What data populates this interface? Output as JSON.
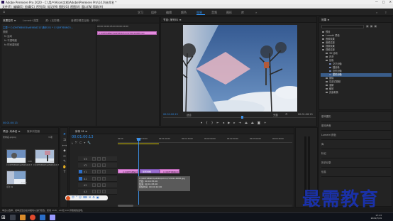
{
  "window": {
    "title": "Adobe Premiere Pro 2020 - C:\\用户\\Alice\\文档\\Adobe\\Premiere Pro\\14.0\\未命名 *",
    "controls": [
      "—",
      "□",
      "✕"
    ]
  },
  "menubar": [
    "文件(F)",
    "编辑(E)",
    "剪辑(C)",
    "序列(S)",
    "标记(M)",
    "图形(G)",
    "视图(V)",
    "窗口(W)",
    "帮助(H)"
  ],
  "workspaces": {
    "items": [
      "学习",
      "组件",
      "编辑",
      "颜色",
      "效果",
      "音频",
      "图形",
      "库"
    ],
    "active_index": 4
  },
  "source_panel": {
    "tabs": [
      "效果控件 ≡",
      "Lumetri 范围",
      "源：(无剪辑)",
      "音频剪辑混合器：序列01"
    ],
    "clip_path": "主要 * C:\\DMT6BN03\\s6f46\\6211\\7...",
    "sequence_ref": "序列 01 * C:\\DMT6BN03...",
    "sections": [
      "视频",
      "fx 运动",
      "fx 不透明度",
      "fx 时间重映射"
    ],
    "mini_timecode": "00:00    00:00:05:00   00:00:10:00",
    "mini_clip_label": "C:\\DMT6BN03\\s6f46\\6211\\7230214688.jpg",
    "bottom_timecode": "00:01:00:13"
  },
  "program_monitor": {
    "tab": "节目: 序列01 ≡",
    "timecode_current": "00:01:00:13",
    "fit": "适合",
    "quality": "完整",
    "timecode_total": "00:01:08:13",
    "transport_icons": [
      "marker",
      "in",
      "out",
      "go-to-in",
      "step-back",
      "play",
      "step-forward",
      "go-to-out",
      "lift",
      "extract",
      "export-frame",
      "button-editor"
    ]
  },
  "effects_panel": {
    "tab": "效果 ≡",
    "tree": [
      {
        "label": "预设",
        "depth": 0
      },
      {
        "label": "Lumetri 预设",
        "depth": 0
      },
      {
        "label": "音频效果",
        "depth": 0
      },
      {
        "label": "音频过渡",
        "depth": 0
      },
      {
        "label": "视频效果",
        "depth": 0
      },
      {
        "label": "视频过渡",
        "depth": 0
      },
      {
        "label": "3D 运动",
        "depth": 1
      },
      {
        "label": "内滑",
        "depth": 1
      },
      {
        "label": "划像",
        "depth": 1
      },
      {
        "label": "交叉划像",
        "depth": 2
      },
      {
        "label": "圆划像",
        "depth": 2
      },
      {
        "label": "盒形划像",
        "depth": 2
      },
      {
        "label": "菱形划像",
        "depth": 2,
        "selected": true
      },
      {
        "label": "擦除",
        "depth": 1
      },
      {
        "label": "沉浸式视频",
        "depth": 1
      },
      {
        "label": "溶解",
        "depth": 1
      },
      {
        "label": "缩放",
        "depth": 1
      },
      {
        "label": "页面剥落",
        "depth": 1
      }
    ],
    "lower_items": [
      "基本图形",
      "基本声音",
      "Lumetri 颜色",
      "库",
      "标记",
      "历史记录",
      "信息"
    ]
  },
  "project_panel": {
    "tabs": [
      "项目: 未命名 ≡",
      "媒体浏览器"
    ],
    "project_name": "未命名.prproj",
    "item_count": "3 项",
    "items": [
      {
        "name": "C:\\DMT6BN03\\s6f46\\6211\\7...",
        "dur": "5:00"
      },
      {
        "name": "C:\\DMT6BN03\\s6f46\\6211\\7...",
        "dur": "5:00"
      },
      {
        "name": "序列 01",
        "dur": "15:00"
      }
    ]
  },
  "timeline": {
    "tab": "序列 01 ≡",
    "timecode": "00:01:00:13",
    "ruler": [
      "00:00",
      "00:00:30:00",
      "00:01:00:00",
      "00:01:30:00",
      "00:02:00:00",
      "00:02:30:00",
      "00:03:00:00",
      "00:03:30:00"
    ],
    "video_tracks": [
      "V3",
      "V2",
      "V1"
    ],
    "audio_tracks": [
      "A1",
      "A2",
      "A3"
    ],
    "master": "主声道",
    "master_value": "0.0",
    "clips": [
      {
        "label": "C:\\DMT6BN03\\s6f46\\6211\\7..."
      },
      {
        "label": "菱形划像"
      },
      {
        "label": "C:\\DMT6BN03\\s6f46\\6211\\7..."
      }
    ],
    "tooltip": [
      "C:\\DMT6BN03\\s6f46\\6211\\7230214688.jpg",
      "开始: 00:00:55:00",
      "结束: 00:01:05:00",
      "持续时间: 00:00:10:00"
    ]
  },
  "status": {
    "text": "单击以选择，或单击空白处并拖动以进行框选。使用 Shift、Alt 和 Ctrl 获取其他选项。"
  },
  "watermark": "最需教育",
  "taskbar": {
    "time": "17:13",
    "date": "2021/7/19"
  },
  "colors": {
    "accent": "#2d8ceb",
    "clip_pink": "#e58ee0",
    "selected_tree": "#3a5d8a",
    "playhead": "#3b8fe6",
    "watermark": "#1a31a8"
  }
}
